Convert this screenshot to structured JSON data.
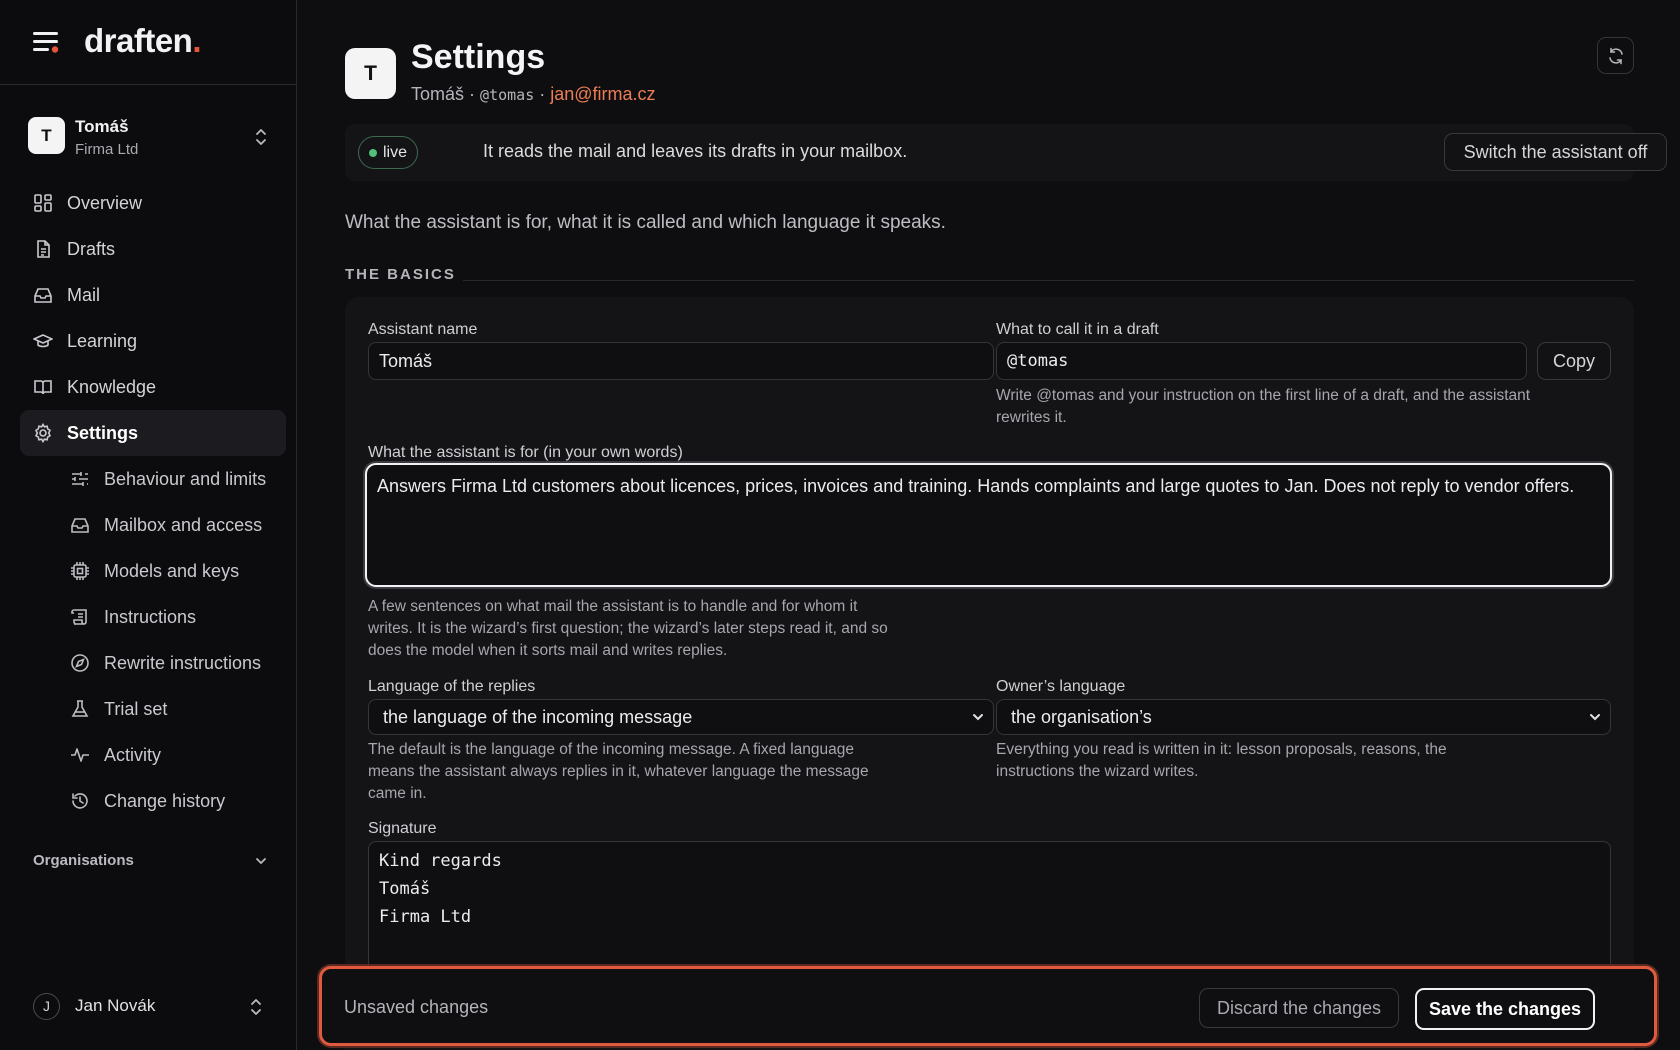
{
  "brand": {
    "name": "draften",
    "dot": "."
  },
  "account": {
    "initial": "T",
    "name": "Tomáš",
    "org": "Firma Ltd"
  },
  "nav": [
    {
      "label": "Overview",
      "icon": "grid-icon"
    },
    {
      "label": "Drafts",
      "icon": "document-icon"
    },
    {
      "label": "Mail",
      "icon": "inbox-icon"
    },
    {
      "label": "Learning",
      "icon": "graduation-cap-icon"
    },
    {
      "label": "Knowledge",
      "icon": "book-icon"
    },
    {
      "label": "Settings",
      "icon": "gear-icon",
      "active": true
    }
  ],
  "subnav": [
    {
      "label": "Behaviour and limits",
      "icon": "sliders-icon"
    },
    {
      "label": "Mailbox and access",
      "icon": "inbox-icon"
    },
    {
      "label": "Models and keys",
      "icon": "chip-icon"
    },
    {
      "label": "Instructions",
      "icon": "scroll-icon"
    },
    {
      "label": "Rewrite instructions",
      "icon": "compass-icon"
    },
    {
      "label": "Trial set",
      "icon": "flask-icon"
    },
    {
      "label": "Activity",
      "icon": "pulse-icon"
    },
    {
      "label": "Change history",
      "icon": "history-icon"
    }
  ],
  "organisations": {
    "label": "Organisations"
  },
  "user": {
    "initial": "J",
    "name": "Jan Novák"
  },
  "header": {
    "initial": "T",
    "title": "Settings",
    "sub_name": "Tomáš",
    "sep": "·",
    "sub_handle": "@tomas",
    "sub_email": "jan@firma.cz"
  },
  "banner": {
    "status": "live",
    "message": "It reads the mail and leaves its drafts in your mailbox.",
    "switch_off_label": "Switch the assistant off"
  },
  "lede": "What the assistant is for, what it is called and which language it speaks.",
  "section_title": "THE BASICS",
  "form": {
    "name_label": "Assistant name",
    "name_value": "Tomáš",
    "call_label": "What to call it in a draft",
    "call_value": "@tomas",
    "copy_label": "Copy",
    "call_help": "Write @tomas and your instruction on the first line of a draft, and the assistant rewrites it.",
    "purpose_label": "What the assistant is for (in your own words)",
    "purpose_value": "Answers Firma Ltd customers about licences, prices, invoices and training. Hands complaints and large quotes to Jan. Does not reply to vendor offers.",
    "purpose_help": "A few sentences on what mail the assistant is to handle and for whom it writes. It is the wizard’s first question; the wizard’s later steps read it, and so does the model when it sorts mail and writes replies.",
    "reply_lang_label": "Language of the replies",
    "reply_lang_value": "the language of the incoming message",
    "reply_lang_help": "The default is the language of the incoming message. A fixed language means the assistant always replies in it, whatever language the message came in.",
    "owner_lang_label": "Owner’s language",
    "owner_lang_value": "the organisation’s",
    "owner_lang_help": "Everything you read is written in it: lesson proposals, reasons, the instructions the wizard writes.",
    "signature_label": "Signature",
    "signature_value": "Kind regards\nTomáš\nFirma Ltd"
  },
  "savebar": {
    "status": "Unsaved changes",
    "discard_label": "Discard the changes",
    "save_label": "Save the changes"
  },
  "colors": {
    "accent": "#e8543a",
    "email": "#ec7d55",
    "live": "#4fc07a",
    "background": "#0e0e10"
  }
}
